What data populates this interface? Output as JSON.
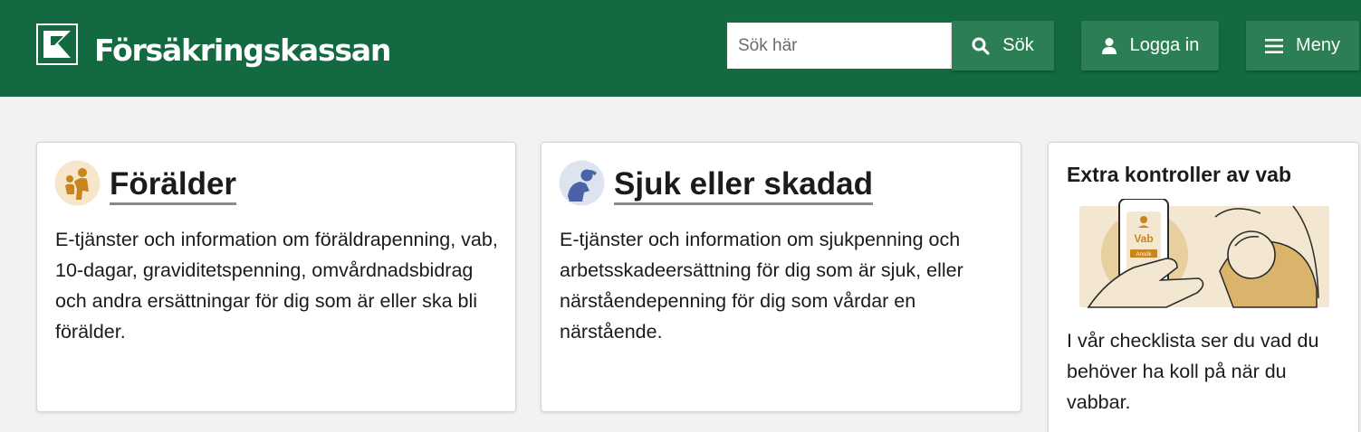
{
  "header": {
    "logo_text": "Försäkringskassan",
    "search": {
      "placeholder": "Sök här",
      "value": ""
    },
    "search_button_label": "Sök",
    "login_button_label": "Logga in",
    "menu_button_label": "Meny",
    "background_color": "#136a40",
    "button_color": "#2c7f55"
  },
  "cards": [
    {
      "title": "Förälder",
      "icon": "parent-child-icon",
      "text": "E-tjänster och information om föräldrapenning, vab, 10-dagar, graviditetspenning, omvårdnadsbidrag och andra ersättningar för dig som är eller ska bli förälder."
    },
    {
      "title": "Sjuk eller skadad",
      "icon": "sick-person-icon",
      "text": "E-tjänster och information om sjukpenning och arbetsskadeersättning för dig som är sjuk, eller närståendepenning för dig som vårdar en närstående."
    },
    {
      "title": "Extra kontroller av vab",
      "illustration": "phone-vab-child-illustration",
      "illustration_phone_label": "Vab",
      "illustration_phone_button": "Ansök",
      "text": "I vår checklista ser du vad du behöver ha koll på när du vabbar."
    }
  ]
}
